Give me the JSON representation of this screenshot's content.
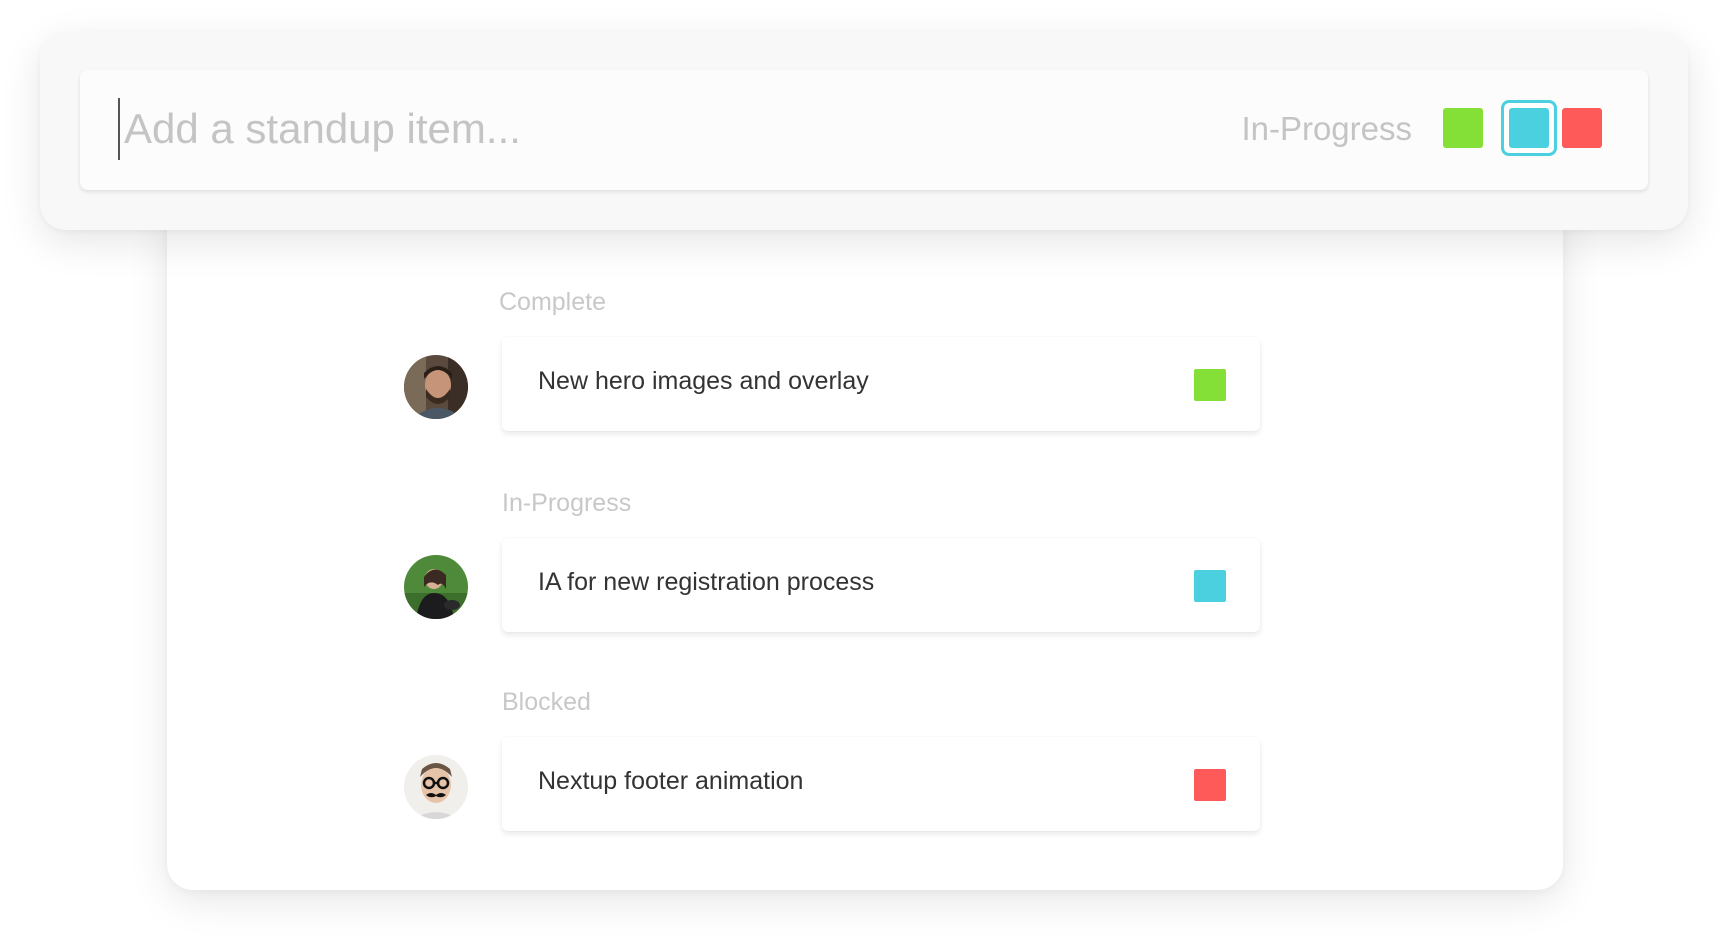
{
  "composer": {
    "placeholder": "Add a standup item...",
    "status_label": "In-Progress",
    "swatches": [
      {
        "name": "complete",
        "color": "#84e036"
      },
      {
        "name": "in-progress",
        "color": "#4bd0e0",
        "selected": true
      },
      {
        "name": "blocked",
        "color": "#ff5a5a"
      }
    ]
  },
  "sections": [
    {
      "label": "Complete",
      "item": {
        "text": "New hero images and overlay",
        "color": "#84e036",
        "avatar": "avatar-man-beard"
      }
    },
    {
      "label": "In-Progress",
      "item": {
        "text": "IA for new registration process",
        "color": "#4bd0e0",
        "avatar": "avatar-woman-grass"
      }
    },
    {
      "label": "Blocked",
      "item": {
        "text": "Nextup footer animation",
        "color": "#ff5a5a",
        "avatar": "avatar-man-glasses-mustache"
      }
    }
  ]
}
